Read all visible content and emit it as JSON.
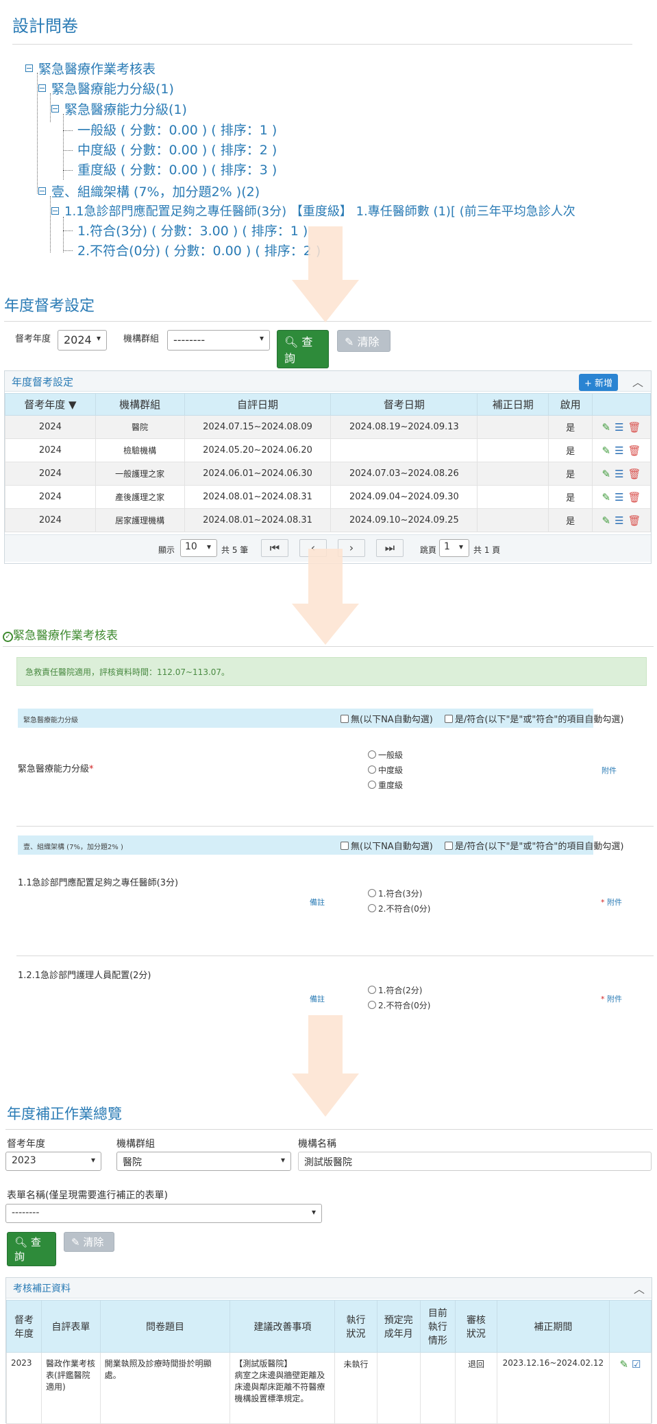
{
  "tree": {
    "title": "設計問卷",
    "nodes": [
      "緊急醫療作業考核表",
      "緊急醫療能力分級(1)",
      "緊急醫療能力分級(1)",
      "一般級 ( 分數：0.00 ) ( 排序：1 )",
      "中度級 ( 分數：0.00 ) ( 排序：2 )",
      "重度級 ( 分數：0.00 ) ( 排序：3 )",
      "壹、組織架構 (7%，加分題2% )(2)",
      "1.1急診部門應配置足夠之專任醫師(3分) 【重度級】 1.專任醫師數 (1)[ (前三年平均急診人次",
      "1.符合(3分) ( 分數：3.00 ) ( 排序：1 )",
      "2.不符合(0分) ( 分數：0.00 ) ( 排序：2 )"
    ]
  },
  "annual": {
    "title": "年度督考設定",
    "year_label": "督考年度",
    "year_value": "2024",
    "group_label": "機構群組",
    "group_value": "--------",
    "search_label": "查詢",
    "clear_label": "清除",
    "panel_title": "年度督考設定",
    "add_label": "新增",
    "columns": [
      "督考年度 ▼",
      "機構群組",
      "自評日期",
      "督考日期",
      "補正日期",
      "啟用"
    ],
    "rows": [
      [
        "2024",
        "醫院",
        "2024.07.15~2024.08.09",
        "2024.08.19~2024.09.13",
        "",
        "是"
      ],
      [
        "2024",
        "檢驗機構",
        "2024.05.20~2024.06.20",
        "",
        "",
        "是"
      ],
      [
        "2024",
        "一般護理之家",
        "2024.06.01~2024.06.30",
        "2024.07.03~2024.08.26",
        "",
        "是"
      ],
      [
        "2024",
        "產後護理之家",
        "2024.08.01~2024.08.31",
        "2024.09.04~2024.09.30",
        "",
        "是"
      ],
      [
        "2024",
        "居家護理機構",
        "2024.08.01~2024.08.31",
        "2024.09.10~2024.09.25",
        "",
        "是"
      ]
    ],
    "pager": {
      "show_label": "顯示",
      "page_size": "10",
      "total_label": "共 5 筆",
      "jump_label": "跳頁",
      "page_value": "1",
      "pages_label": "共 1 頁"
    }
  },
  "form": {
    "title": "緊急醫療作業考核表",
    "notice": "急救責任醫院適用，評核資料時間：112.07~113.07。",
    "sections": [
      {
        "name": "緊急醫療能力分級",
        "check_na": "無(以下NA自動勾選)",
        "check_yes": "是/符合(以下\"是\"或\"符合\"的項目自動勾選)"
      },
      {
        "name": "壹、組織架構 (7%，加分題2% )",
        "check_na": "無(以下NA自動勾選)",
        "check_yes": "是/符合(以下\"是\"或\"符合\"的項目自動勾選)"
      }
    ],
    "q1": {
      "label": "緊急醫療能力分級",
      "required": "*",
      "options": [
        "一般級",
        "中度級",
        "重度級"
      ],
      "attach": "附件"
    },
    "q2": {
      "label": "1.1急診部門應配置足夠之專任醫師(3分)",
      "note": "備註",
      "options": [
        "1.符合(3分)",
        "2.不符合(0分)"
      ],
      "required": "*",
      "attach": "附件"
    },
    "q3": {
      "label": "1.2.1急診部門護理人員配置(2分)",
      "note": "備註",
      "options": [
        "1.符合(2分)",
        "2.不符合(0分)"
      ],
      "required": "*",
      "attach": "附件"
    }
  },
  "correction": {
    "title": "年度補正作業總覽",
    "year_label": "督考年度",
    "year_value": "2023",
    "group_label": "機構群組",
    "group_value": "醫院",
    "name_label": "機構名稱",
    "name_value": "測試版醫院",
    "form_label": "表單名稱(僅呈現需要進行補正的表單)",
    "form_value": "--------",
    "search_label": "查詢",
    "clear_label": "清除",
    "panel_title": "考核補正資料",
    "columns": [
      "督考年度",
      "自評表單",
      "問卷題目",
      "建議改善事項",
      "執行狀況",
      "預定完成年月",
      "目前執行情形",
      "審核狀況",
      "補正期間"
    ],
    "row": {
      "year": "2023",
      "form": "醫政作業考核表(評鑑醫院適用)",
      "question": "開業執照及診療時間掛於明顯處。",
      "suggestion": "【測試版醫院】\n病室之床邊與牆壁距離及床邊與鄰床距離不符醫療機構設置標準規定。",
      "status": "未執行",
      "planned": "",
      "current": "",
      "review": "退回",
      "period": "2023.12.16~2024.02.12"
    }
  },
  "colors": {
    "accent": "#2a7bb5",
    "green": "#2e8b3a",
    "arrow": "#fde3d0",
    "table_head": "#d5eef8"
  }
}
